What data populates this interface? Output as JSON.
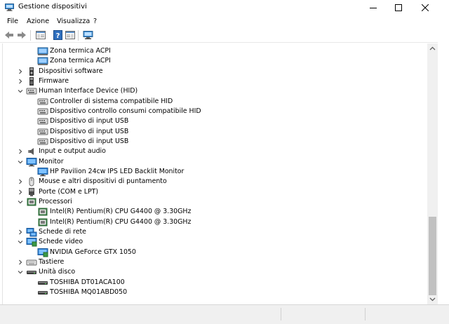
{
  "window": {
    "title": "Gestione dispositivi"
  },
  "menu": {
    "file": "File",
    "azione": "Azione",
    "visualizza": "Visualizza",
    "help": "?"
  },
  "tree": [
    {
      "label": "Zona termica ACPI",
      "icon": "thermal-zone-icon",
      "depth": 2
    },
    {
      "label": "Zona termica ACPI",
      "icon": "thermal-zone-icon",
      "depth": 2
    },
    {
      "label": "Dispositivi software",
      "icon": "software-device-icon",
      "depth": 1,
      "expander": "collapsed"
    },
    {
      "label": "Firmware",
      "icon": "firmware-icon",
      "depth": 1,
      "expander": "collapsed"
    },
    {
      "label": "Human Interface Device (HID)",
      "icon": "hid-icon",
      "depth": 1,
      "expander": "expanded"
    },
    {
      "label": "Controller di sistema compatibile HID",
      "icon": "hid-icon",
      "depth": 2
    },
    {
      "label": "Dispositivo controllo consumi compatibile HID",
      "icon": "hid-icon",
      "depth": 2
    },
    {
      "label": "Dispositivo di input USB",
      "icon": "hid-icon",
      "depth": 2
    },
    {
      "label": "Dispositivo di input USB",
      "icon": "hid-icon",
      "depth": 2
    },
    {
      "label": "Dispositivo di input USB",
      "icon": "hid-icon",
      "depth": 2
    },
    {
      "label": "Input e output audio",
      "icon": "speaker-icon",
      "depth": 1,
      "expander": "collapsed"
    },
    {
      "label": "Monitor",
      "icon": "monitor-icon",
      "depth": 1,
      "expander": "expanded"
    },
    {
      "label": "HP Pavilion 24cw IPS LED Backlit Monitor",
      "icon": "monitor-icon",
      "depth": 2
    },
    {
      "label": "Mouse e altri dispositivi di puntamento",
      "icon": "mouse-icon",
      "depth": 1,
      "expander": "collapsed"
    },
    {
      "label": "Porte (COM e LPT)",
      "icon": "port-icon",
      "depth": 1,
      "expander": "collapsed"
    },
    {
      "label": "Processori",
      "icon": "processor-icon",
      "depth": 1,
      "expander": "expanded"
    },
    {
      "label": "Intel(R) Pentium(R) CPU G4400 @ 3.30GHz",
      "icon": "processor-icon",
      "depth": 2
    },
    {
      "label": "Intel(R) Pentium(R) CPU G4400 @ 3.30GHz",
      "icon": "processor-icon",
      "depth": 2
    },
    {
      "label": "Schede di rete",
      "icon": "network-adapter-icon",
      "depth": 1,
      "expander": "collapsed"
    },
    {
      "label": "Schede video",
      "icon": "display-adapter-icon",
      "depth": 1,
      "expander": "expanded"
    },
    {
      "label": "NVIDIA GeForce GTX 1050",
      "icon": "display-adapter-icon",
      "depth": 2
    },
    {
      "label": "Tastiere",
      "icon": "keyboard-icon",
      "depth": 1,
      "expander": "collapsed"
    },
    {
      "label": "Unità disco",
      "icon": "disk-drive-icon",
      "depth": 1,
      "expander": "expanded"
    },
    {
      "label": "TOSHIBA DT01ACA100",
      "icon": "disk-drive-icon",
      "depth": 2
    },
    {
      "label": "TOSHIBA MQ01ABD050",
      "icon": "disk-drive-icon",
      "depth": 2
    }
  ],
  "toolbar": {
    "buttons": [
      "back-icon",
      "forward-icon",
      "properties-view-icon",
      "help-icon",
      "update-view-icon",
      "scan-hardware-icon"
    ]
  },
  "colors": {
    "accent": "#0078d7",
    "selection": "#cce8ff"
  }
}
